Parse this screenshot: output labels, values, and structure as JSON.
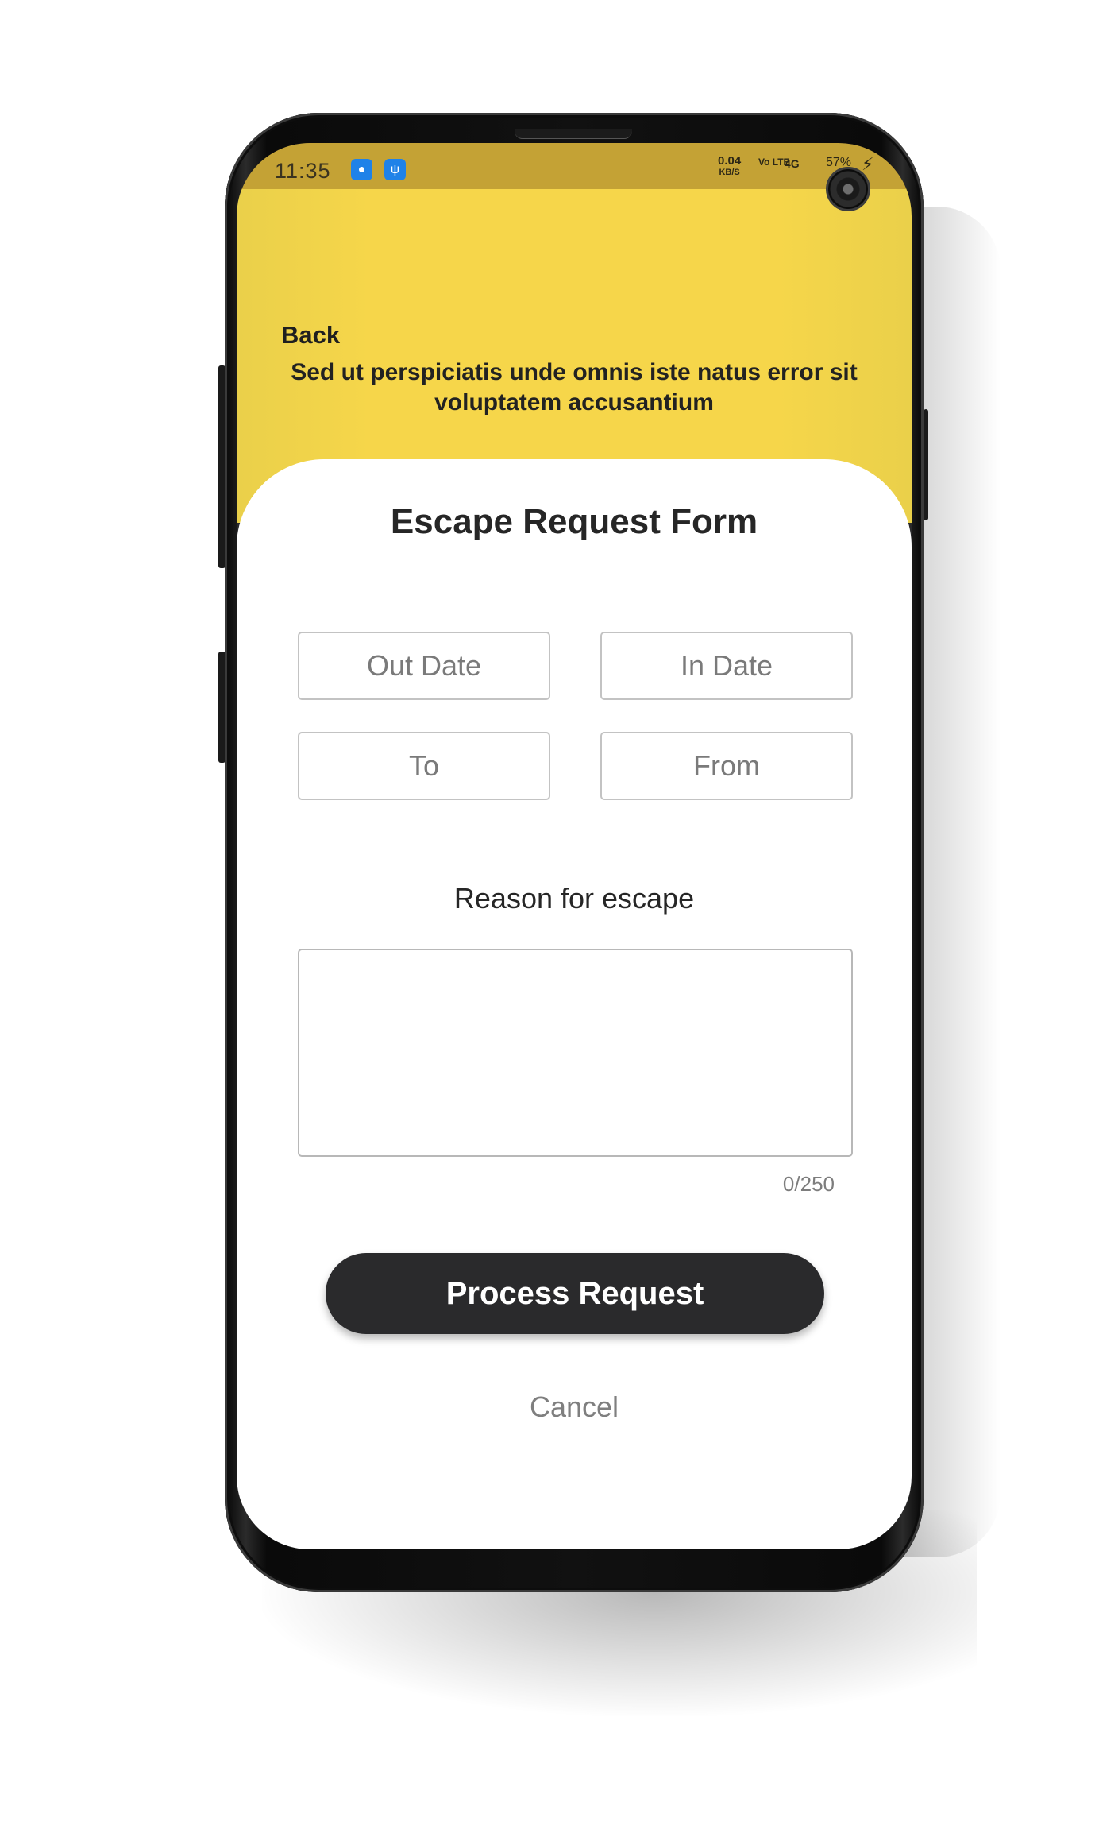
{
  "status_bar": {
    "time": "11:35",
    "icons": [
      "android-icon",
      "usb-icon"
    ],
    "net_speed": "0.04",
    "net_speed_unit": "KB/S",
    "volte": "Vo LTE",
    "network": "4G",
    "battery": "57%"
  },
  "header": {
    "back_label": "Back",
    "tagline": "Sed ut perspiciatis unde omnis iste natus error sit voluptatem accusantium",
    "accent_color": "#F6D64A"
  },
  "form": {
    "title": "Escape Request Form",
    "out_date_placeholder": "Out Date",
    "in_date_placeholder": "In Date",
    "to_placeholder": "To",
    "from_placeholder": "From",
    "reason_label": "Reason for escape",
    "reason_value": "",
    "counter": "0/250",
    "submit_label": "Process Request",
    "cancel_label": "Cancel",
    "button_color": "#2A2A2C"
  }
}
